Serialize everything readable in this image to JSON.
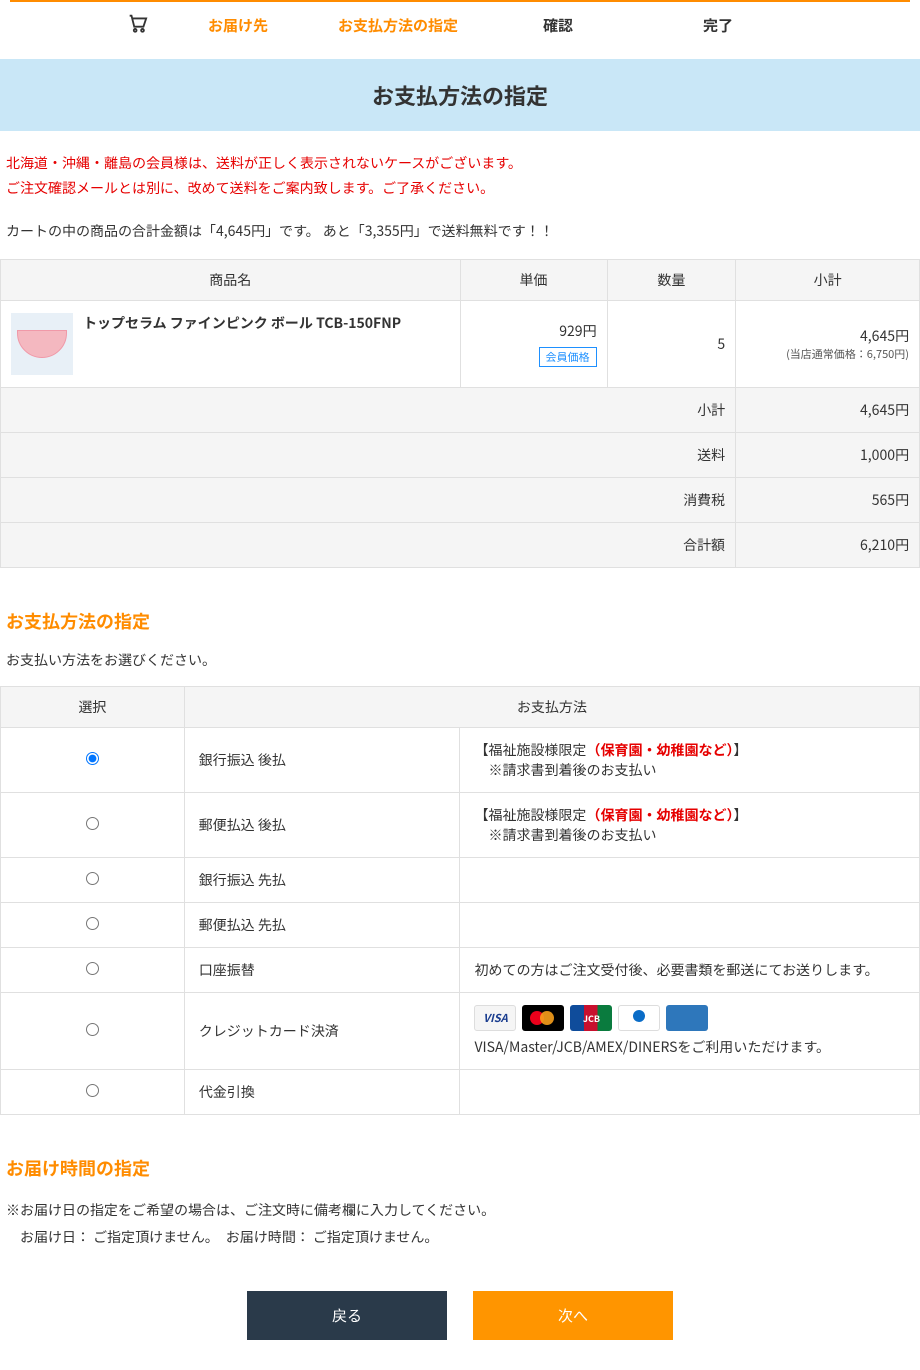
{
  "steps": {
    "s1": "お届け先",
    "s2": "お支払方法の指定",
    "s3": "確認",
    "s4": "完了"
  },
  "page_title": "お支払方法の指定",
  "notice_red_1": "北海道・沖縄・離島の会員様は、送料が正しく表示されないケースがございます。",
  "notice_red_2": "ご注文確認メールとは別に、改めて送料をご案内致します。ご了承ください。",
  "cart_msg": "カートの中の商品の合計金額は「4,645円」です。 あと「3,355円」で送料無料です！！",
  "headers": {
    "name": "商品名",
    "unit": "単価",
    "qty": "数量",
    "sub": "小計"
  },
  "item": {
    "name": "トップセラム ファインピンク ボール TCB-150FNP",
    "unit": "929円",
    "badge": "会員価格",
    "qty": "5",
    "sub": "4,645円",
    "reg": "(当店通常価格：6,750円)"
  },
  "totals": [
    {
      "label": "小計",
      "value": "4,645円"
    },
    {
      "label": "送料",
      "value": "1,000円"
    },
    {
      "label": "消費税",
      "value": "565円"
    },
    {
      "label": "合計額",
      "value": "6,210円"
    }
  ],
  "pay_section_title": "お支払方法の指定",
  "pay_lead": "お支払い方法をお選びください。",
  "pay_headers": {
    "sel": "選択",
    "method": "お支払方法"
  },
  "limited_prefix": "【福祉施設様限定",
  "limited_red": "（保育園・幼稚園など）",
  "limited_suffix": "】",
  "limited_sub": "　※請求書到着後のお支払い",
  "pay_methods": [
    {
      "name": "銀行振込 後払",
      "desc_type": "limited"
    },
    {
      "name": "郵便払込 後払",
      "desc_type": "limited"
    },
    {
      "name": "銀行振込 先払",
      "desc_type": "none"
    },
    {
      "name": "郵便払込 先払",
      "desc_type": "none"
    },
    {
      "name": "口座振替",
      "desc_type": "text",
      "desc": "初めての方はご注文受付後、必要書類を郵送にてお送りします。"
    },
    {
      "name": "クレジットカード決済",
      "desc_type": "cards",
      "desc": "VISA/Master/JCB/AMEX/DINERSをご利用いただけます。"
    },
    {
      "name": "代金引換",
      "desc_type": "none"
    }
  ],
  "deliver_title": "お届け時間の指定",
  "deliver_note1": "※お届け日の指定をご希望の場合は、ご注文時に備考欄に入力してください。",
  "deliver_note2": "　お届け日： ご指定頂けません。　お届け時間： ご指定頂けません。",
  "buttons": {
    "back": "戻る",
    "next": "次へ"
  },
  "card_labels": {
    "visa": "VISA",
    "jcb": "JCB",
    "diners": "Diners Club",
    "amex": "AMEX"
  }
}
